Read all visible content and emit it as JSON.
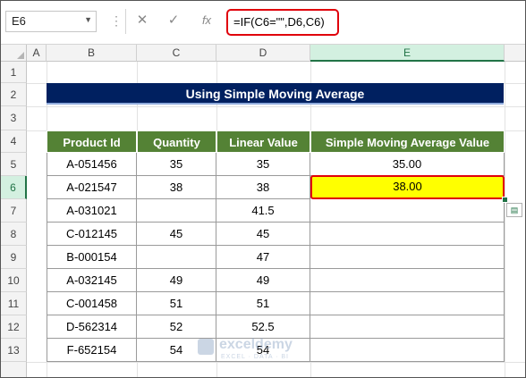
{
  "name_box": "E6",
  "formula": "=IF(C6=\"\",D6,C6)",
  "formula_buttons": {
    "cancel": "✕",
    "enter": "✓",
    "fx": "fx"
  },
  "columns": [
    "A",
    "B",
    "C",
    "D",
    "E"
  ],
  "rows": [
    "1",
    "2",
    "3",
    "4",
    "5",
    "6",
    "7",
    "8",
    "9",
    "10",
    "11",
    "12",
    "13"
  ],
  "title": "Using Simple Moving Average",
  "table": {
    "headers": [
      "Product Id",
      "Quantity",
      "Linear Value",
      "Simple Moving Average Value"
    ],
    "rows": [
      [
        "A-051456",
        "35",
        "35",
        "35.00"
      ],
      [
        "A-021547",
        "38",
        "38",
        "38.00"
      ],
      [
        "A-031021",
        "",
        "41.5",
        ""
      ],
      [
        "C-012145",
        "45",
        "45",
        ""
      ],
      [
        "B-000154",
        "",
        "47",
        ""
      ],
      [
        "A-032145",
        "49",
        "49",
        ""
      ],
      [
        "C-001458",
        "51",
        "51",
        ""
      ],
      [
        "D-562314",
        "52",
        "52.5",
        ""
      ],
      [
        "F-652154",
        "54",
        "54",
        ""
      ]
    ]
  },
  "watermark": {
    "name": "exceldemy",
    "tagline": "EXCEL · DATA · BI"
  },
  "colors": {
    "title_bg": "#002060",
    "header_bg": "#548235",
    "highlight": "#ffff00",
    "border_red": "#e0000b",
    "excel_green": "#217346"
  }
}
